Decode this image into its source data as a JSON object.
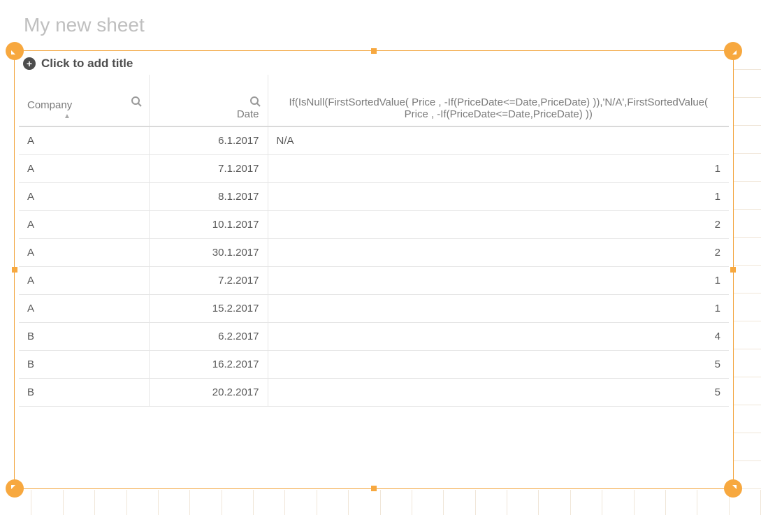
{
  "sheet_title": "My new sheet",
  "object": {
    "title_placeholder": "Click to add title",
    "columns": {
      "company": "Company",
      "date": "Date",
      "expr": "If(IsNull(FirstSortedValue( Price , -If(PriceDate<=Date,PriceDate) )),'N/A',FirstSortedValue( Price , -If(PriceDate<=Date,PriceDate) ))"
    },
    "rows": [
      {
        "company": "A",
        "date": "6.1.2017",
        "value": "N/A"
      },
      {
        "company": "A",
        "date": "7.1.2017",
        "value": "1"
      },
      {
        "company": "A",
        "date": "8.1.2017",
        "value": "1"
      },
      {
        "company": "A",
        "date": "10.1.2017",
        "value": "2"
      },
      {
        "company": "A",
        "date": "30.1.2017",
        "value": "2"
      },
      {
        "company": "A",
        "date": "7.2.2017",
        "value": "1"
      },
      {
        "company": "A",
        "date": "15.2.2017",
        "value": "1"
      },
      {
        "company": "B",
        "date": "6.2.2017",
        "value": "4"
      },
      {
        "company": "B",
        "date": "16.2.2017",
        "value": "5"
      },
      {
        "company": "B",
        "date": "20.2.2017",
        "value": "5"
      }
    ]
  },
  "colors": {
    "selection": "#f7a83f"
  }
}
